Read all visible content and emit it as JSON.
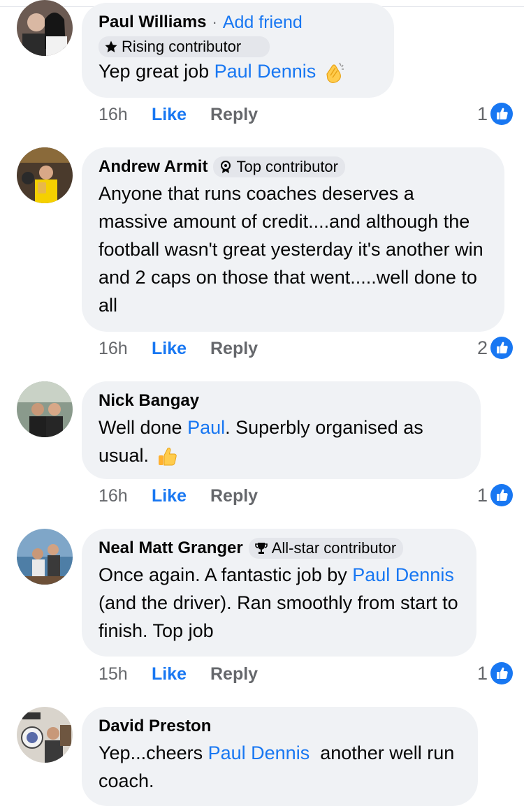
{
  "colors": {
    "accent": "#1877f2",
    "bubble": "#f0f2f5",
    "secondary_text": "#65676b"
  },
  "comments": [
    {
      "author": "Paul Williams",
      "add_friend": "Add friend",
      "badge": {
        "icon": "star-icon",
        "label": "Rising contributor"
      },
      "text_before": "Yep great job ",
      "mention": "Paul Dennis",
      "text_after": "",
      "emoji": "clapping-hands-emoji",
      "time": "16h",
      "like_label": "Like",
      "reply_label": "Reply",
      "reaction_count": "1"
    },
    {
      "author": "Andrew Armit",
      "badge": {
        "icon": "award-icon",
        "label": "Top contributor"
      },
      "text": "Anyone that runs coaches deserves a massive amount of credit....and although the football wasn't great yesterday it's another win and 2 caps on those that went.....well done to all",
      "time": "16h",
      "like_label": "Like",
      "reply_label": "Reply",
      "reaction_count": "2"
    },
    {
      "author": "Nick Bangay",
      "text_before": "Well done ",
      "mention": "Paul",
      "text_after": ". Superbly organised as usual. ",
      "emoji": "thumbs-up-emoji",
      "time": "16h",
      "like_label": "Like",
      "reply_label": "Reply",
      "reaction_count": "1"
    },
    {
      "author": "Neal Matt Granger",
      "badge": {
        "icon": "trophy-icon",
        "label": "All-star contributor"
      },
      "text_before": "Once again. A fantastic job by ",
      "mention": "Paul Dennis",
      "text_after": " (and the driver). Ran smoothly from start to finish. Top job",
      "time": "15h",
      "like_label": "Like",
      "reply_label": "Reply",
      "reaction_count": "1"
    },
    {
      "author": "David Preston",
      "text_before": "Yep...cheers ",
      "mention": "Paul Dennis",
      "text_after": "  another well run coach."
    }
  ]
}
